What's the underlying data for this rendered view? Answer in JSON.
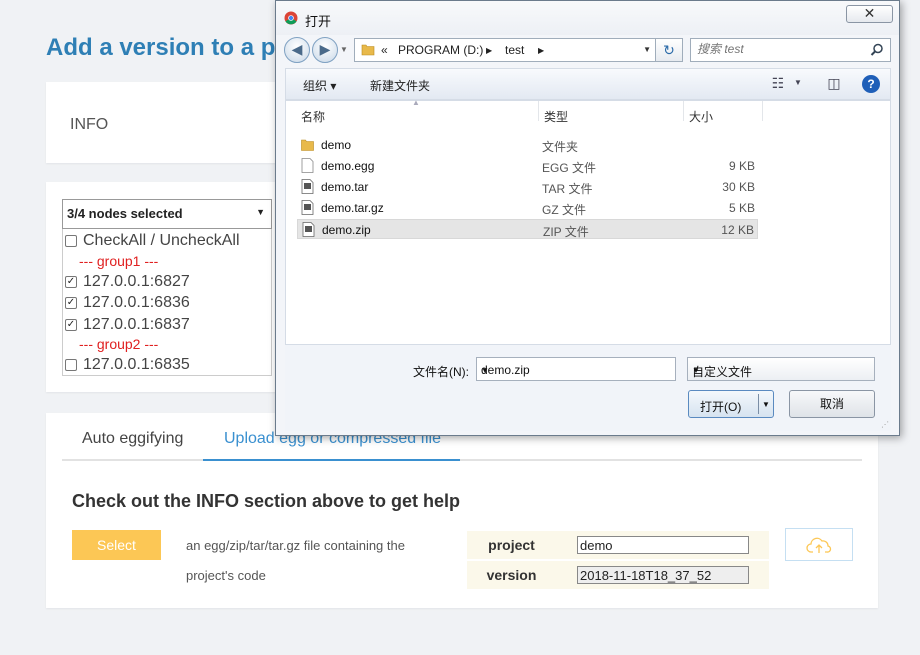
{
  "page": {
    "title": "Add a version to a p",
    "info_label": "INFO",
    "node_select": {
      "value": "3/4 nodes selected"
    },
    "check_all_label": "CheckAll / UncheckAll",
    "groups": [
      {
        "label": "--- group1 ---",
        "nodes": [
          {
            "address": "127.0.0.1:6827",
            "checked": true
          },
          {
            "address": "127.0.0.1:6836",
            "checked": true
          },
          {
            "address": "127.0.0.1:6837",
            "checked": true
          }
        ]
      },
      {
        "label": "--- group2 ---",
        "nodes": [
          {
            "address": "127.0.0.1:6835",
            "checked": false
          }
        ]
      }
    ],
    "tabs": [
      {
        "label": "Auto eggifying",
        "active": false
      },
      {
        "label": "Upload egg or compressed file",
        "active": true
      }
    ],
    "help_text": "Check out the INFO section above to get help",
    "select_button": "Select",
    "description_line1": "an egg/zip/tar/tar.gz file containing the",
    "description_line2": "project's code",
    "project_label": "project",
    "project_value": "demo",
    "version_label": "version",
    "version_value": "2018-11-18T18_37_52",
    "upload_icon": "cloud-upload-icon",
    "colors": {
      "title": "#2e7fb5",
      "accent": "#3a90d0",
      "select_button": "#fcc755",
      "group_label": "#e02020"
    }
  },
  "dialog": {
    "title": "打开",
    "address": {
      "root": "«",
      "drive": "PROGRAM (D:)",
      "folder": "test"
    },
    "search_placeholder": "搜索 test",
    "toolbar": {
      "organize": "组织 ▾",
      "new_folder": "新建文件夹"
    },
    "columns": {
      "name": "名称",
      "type": "类型",
      "size": "大小"
    },
    "files": [
      {
        "name": "demo",
        "type": "文件夹",
        "size": "",
        "icon": "folder-icon",
        "selected": false
      },
      {
        "name": "demo.egg",
        "type": "EGG 文件",
        "size": "9 KB",
        "icon": "blank-file-icon",
        "selected": false
      },
      {
        "name": "demo.tar",
        "type": "TAR 文件",
        "size": "30 KB",
        "icon": "archive-file-icon",
        "selected": false
      },
      {
        "name": "demo.tar.gz",
        "type": "GZ 文件",
        "size": "5 KB",
        "icon": "archive-file-icon",
        "selected": false
      },
      {
        "name": "demo.zip",
        "type": "ZIP 文件",
        "size": "12 KB",
        "icon": "archive-file-icon",
        "selected": true
      }
    ],
    "filename_label": "文件名(N):",
    "filename_value": "demo.zip",
    "filter_value": "自定义文件",
    "open_button": "打开(O)",
    "cancel_button": "取消",
    "close_button": "✕"
  }
}
